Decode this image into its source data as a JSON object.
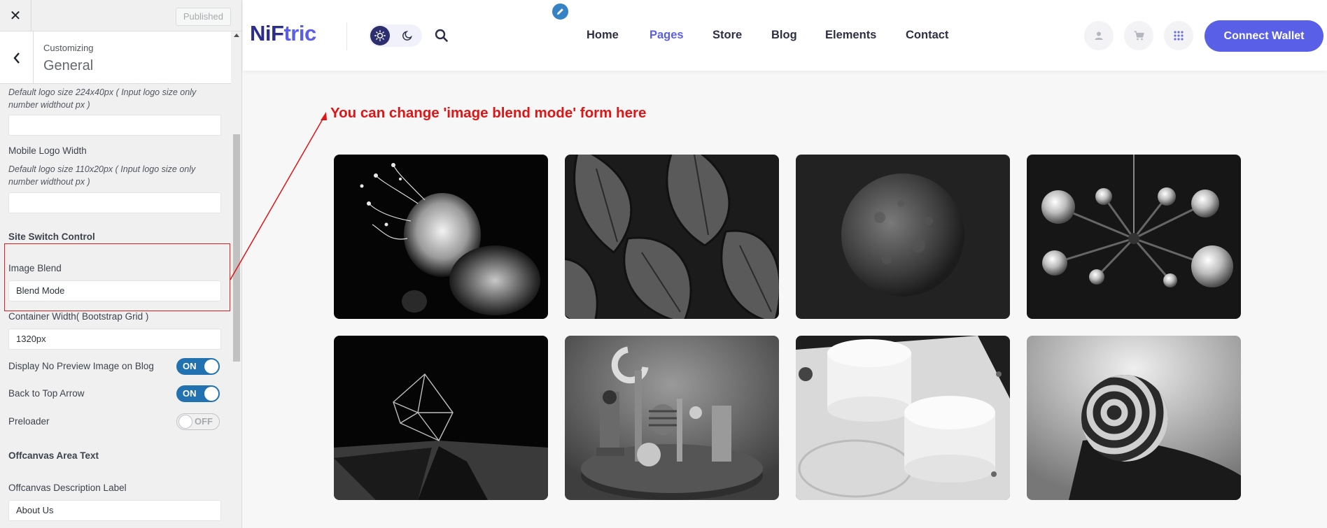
{
  "customizer": {
    "close_icon": "close-icon",
    "publish_label": "Published",
    "breadcrumb": "Customizing",
    "section_title": "General",
    "logo_help": "Default logo size 224x40px ( Input logo size only number widthout px )",
    "logo_width_value": "",
    "mobile_logo_label": "Mobile Logo Width",
    "mobile_logo_help": "Default logo size 110x20px ( Input logo size only number widthout px )",
    "mobile_logo_value": "",
    "site_switch_label": "Site Switch Control",
    "image_blend_label": "Image Blend",
    "image_blend_value": "Blend Mode",
    "container_width_label": "Container Width( Bootstrap Grid )",
    "container_width_value": "1320px",
    "no_preview_label": "Display No Preview Image on Blog",
    "no_preview_state": "ON",
    "back_to_top_label": "Back to Top Arrow",
    "back_to_top_state": "ON",
    "preloader_label": "Preloader",
    "preloader_state": "OFF",
    "offcanvas_area_label": "Offcanvas Area Text",
    "offcanvas_desc_label": "Offcanvas Description Label",
    "offcanvas_desc_value": "About Us"
  },
  "site": {
    "logo_part1": "NiF",
    "logo_part2": "tric",
    "nav": [
      "Home",
      "Pages",
      "Store",
      "Blog",
      "Elements",
      "Contact"
    ],
    "active_nav": "Pages",
    "connect_wallet": "Connect Wallet",
    "accent_color": "#5a5fe8",
    "annotation": "You can change 'image blend mode' form here",
    "annotation_color": "#e01414",
    "gallery": [
      "jellyfish",
      "monstera-leaves",
      "moon-sphere",
      "bulb-chandelier",
      "wireframe-crystal",
      "abstract-shapes",
      "white-cylinders",
      "striped-sphere"
    ]
  }
}
